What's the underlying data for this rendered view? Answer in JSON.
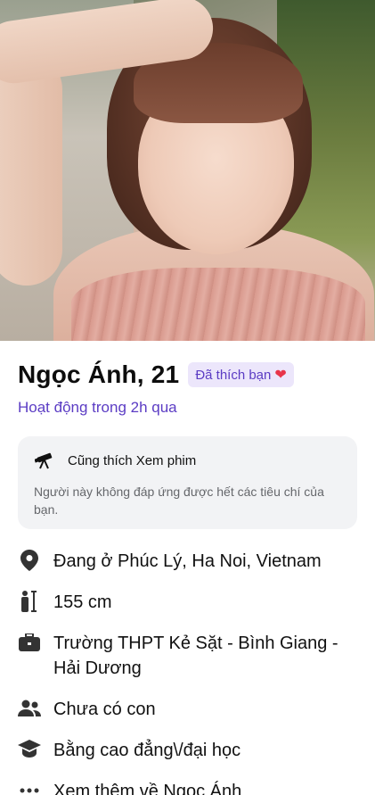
{
  "profile": {
    "name_age": "Ngọc Ánh, 21",
    "like_badge": "Đã thích bạn",
    "active_status": "Hoạt động trong 2h qua"
  },
  "interest": {
    "title": "Cũng thích Xem phim",
    "note": "Người này không đáp ứng được hết các tiêu chí của bạn."
  },
  "details": {
    "location": "Đang ở Phúc Lý, Ha Noi, Vietnam",
    "height": "155 cm",
    "school": "Trường THPT Kẻ Sặt - Bình Giang - Hải Dương",
    "children": "Chưa có con",
    "education": "Bằng cao đẳng\\/đại học",
    "see_more": "Xem thêm về Ngọc Ánh"
  },
  "colors": {
    "accent": "#5b3cc4",
    "badge_bg": "#ece6fb",
    "heart": "#e8344a",
    "card_bg": "#f2f3f5"
  },
  "icons": [
    "location-pin-icon",
    "height-icon",
    "briefcase-icon",
    "people-icon",
    "graduation-cap-icon",
    "more-dots-icon",
    "telescope-icon",
    "heart-icon"
  ]
}
